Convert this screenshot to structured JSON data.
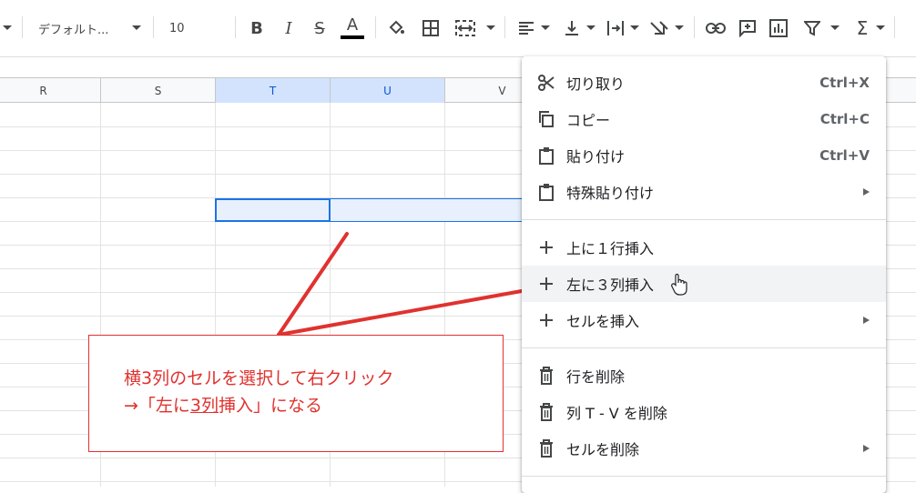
{
  "toolbar": {
    "font": "デフォルト...",
    "font_size": "10",
    "icons": [
      "bold-icon",
      "italic-icon",
      "strikethrough-icon",
      "text-color-icon",
      "fill-color-icon",
      "borders-icon",
      "merge-cells-icon",
      "align-icon",
      "valign-icon",
      "text-wrap-icon",
      "text-rotate-icon",
      "link-icon",
      "comment-icon",
      "chart-icon",
      "filter-icon",
      "functions-icon"
    ]
  },
  "columns": [
    "R",
    "S",
    "T",
    "U",
    "V"
  ],
  "selected_columns": [
    "T",
    "U"
  ],
  "annotation": {
    "line1": "横3列のセルを選択して右クリック",
    "line2_prefix": "→「左に",
    "line2_underlined": "3列",
    "line2_suffix": "挿入」になる",
    "color": "#e0322f"
  },
  "context_menu": {
    "items": [
      {
        "label": "切り取り",
        "shortcut": "Ctrl+X",
        "icon": "scissors-icon"
      },
      {
        "label": "コピー",
        "shortcut": "Ctrl+C",
        "icon": "copy-icon"
      },
      {
        "label": "貼り付け",
        "shortcut": "Ctrl+V",
        "icon": "clipboard-icon"
      },
      {
        "label": "特殊貼り付け",
        "submenu": true,
        "icon": "clipboard-icon"
      },
      {
        "label": "上に１行挿入",
        "icon": "plus-icon"
      },
      {
        "label": "左に３列挿入",
        "icon": "plus-icon",
        "hovered": true
      },
      {
        "label": "セルを挿入",
        "submenu": true,
        "icon": "plus-icon"
      },
      {
        "label": "行を削除",
        "icon": "trash-icon"
      },
      {
        "label": "列 T - V を削除",
        "icon": "trash-icon"
      },
      {
        "label": "セルを削除",
        "submenu": true,
        "icon": "trash-icon"
      }
    ]
  },
  "colors": {
    "accent": "#1a73e8",
    "annotation": "#e0322f",
    "selection_fill": "#e8f0fe"
  }
}
